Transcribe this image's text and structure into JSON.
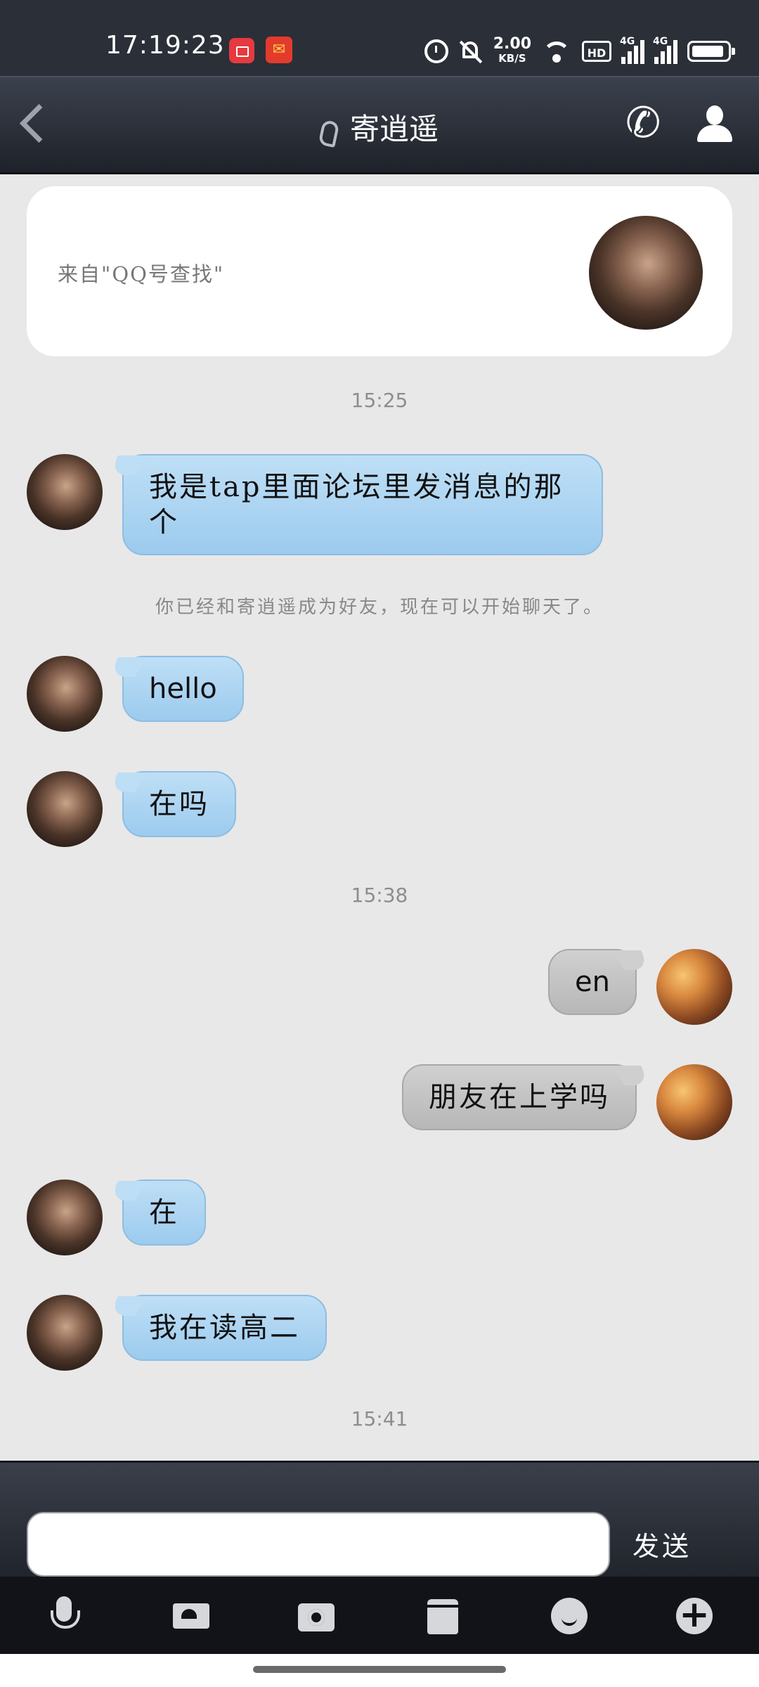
{
  "status_bar": {
    "time": "17:19:23",
    "app_icons": [
      "screen-record-icon",
      "app-notification-icon"
    ],
    "network_speed": "2.00",
    "network_speed_unit": "KB/S",
    "hd_label": "HD",
    "signal_1_label": "4G",
    "signal_2_label": "4G",
    "icons": [
      "alarm-icon",
      "mute-icon",
      "wifi-icon",
      "hd-icon",
      "signal-icon",
      "signal-icon",
      "battery-icon"
    ]
  },
  "header": {
    "title": "寄逍遥",
    "left_icon": "back-icon",
    "title_icon": "ear-icon",
    "right_icons": [
      "phone-icon",
      "profile-icon"
    ]
  },
  "source_card": {
    "text": "来自\"QQ号查找\""
  },
  "chat": {
    "timestamps": [
      "15:25",
      "15:38",
      "15:41"
    ],
    "system_message": "你已经和寄逍遥成为好友，现在可以开始聊天了。",
    "messages": [
      {
        "side": "incoming",
        "text": "我是tap里面论坛里发消息的那个"
      },
      {
        "side": "incoming",
        "text": "hello"
      },
      {
        "side": "incoming",
        "text": "在吗"
      },
      {
        "side": "outgoing",
        "text": "en"
      },
      {
        "side": "outgoing",
        "text": "朋友在上学吗"
      },
      {
        "side": "incoming",
        "text": "在"
      },
      {
        "side": "incoming",
        "text": "我在读高二"
      }
    ]
  },
  "input_bar": {
    "value": "",
    "send_label": "发送"
  },
  "toolbar": {
    "icons": [
      "microphone-icon",
      "photo-album-icon",
      "camera-icon",
      "file-icon",
      "emoji-icon",
      "plus-icon"
    ]
  },
  "colors": {
    "incoming_bubble": "#b3d8f3",
    "outgoing_bubble": "#c4c4c4",
    "chat_background": "#e8e8e8",
    "header_dark": "#2b2f38"
  }
}
